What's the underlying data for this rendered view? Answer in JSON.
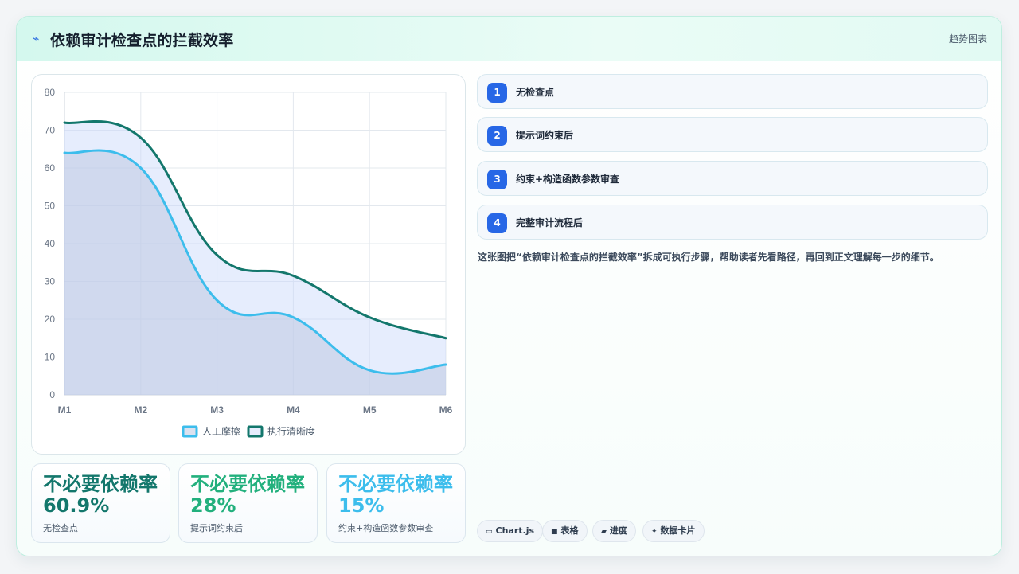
{
  "header": {
    "icon": "bolt-icon",
    "title": "依赖审计检查点的拦截效率",
    "tag": "趋势图表"
  },
  "chart_data": {
    "type": "line",
    "categories": [
      "M1",
      "M2",
      "M3",
      "M4",
      "M5",
      "M6"
    ],
    "ylim": [
      0,
      80
    ],
    "yticks": [
      0,
      10,
      20,
      30,
      40,
      50,
      60,
      70,
      80
    ],
    "grid": true,
    "legend_position": "bottom",
    "series": [
      {
        "name": "人工摩擦",
        "values": [
          64,
          60,
          25,
          20.5,
          6.5,
          8
        ],
        "color": "#3cbdec",
        "fill": "rgba(190,200,225,0.55)"
      },
      {
        "name": "执行清晰度",
        "values": [
          72,
          68,
          37,
          31.5,
          20.5,
          15
        ],
        "color": "#13776c",
        "fill": "rgba(200,215,250,0.45)"
      }
    ]
  },
  "stats": [
    {
      "value": "不必要依赖率 60.9%",
      "caption": "无检查点",
      "color": "#13776c"
    },
    {
      "value": "不必要依赖率 28%",
      "caption": "提示词约束后",
      "color": "#22b07d"
    },
    {
      "value": "不必要依赖率 15%",
      "caption": "约束+构造函数参数审查",
      "color": "#3cbdec"
    }
  ],
  "steps": [
    {
      "num": "1",
      "label": "无检查点"
    },
    {
      "num": "2",
      "label": "提示词约束后"
    },
    {
      "num": "3",
      "label": "约束+构造函数参数审查"
    },
    {
      "num": "4",
      "label": "完整审计流程后"
    }
  ],
  "description": "这张图把“依赖审计检查点的拦截效率”拆成可执行步骤，帮助读者先看路径，再回到正文理解每一步的细节。",
  "chips": [
    {
      "icon": "▭",
      "label": "Chart.js"
    },
    {
      "icon": "■",
      "label": "表格"
    },
    {
      "icon": "▰",
      "label": "进度"
    },
    {
      "icon": "✦",
      "label": "数据卡片"
    }
  ]
}
